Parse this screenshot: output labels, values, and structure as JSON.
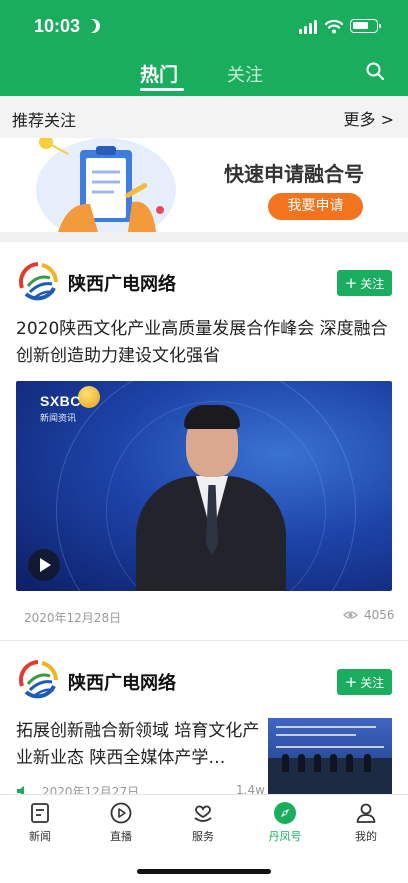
{
  "status_bar": {
    "time": "10:03"
  },
  "header": {
    "tabs": [
      {
        "label": "热门",
        "active": true
      },
      {
        "label": "关注",
        "active": false
      }
    ],
    "search_icon": "search-icon"
  },
  "recommend": {
    "title": "推荐关注",
    "more": "更多 >"
  },
  "banner": {
    "title": "快速申请融合号",
    "button": "我要申请"
  },
  "feed": [
    {
      "account": "陕西广电网络",
      "follow_label": "关注",
      "headline": "2020陕西文化产业高质量发展合作峰会 深度融合创新创造助力建设文化强省",
      "video": {
        "logo": "SXBC",
        "logo_sub": "新闻资讯"
      },
      "date": "2020年12月28日",
      "views": "4056"
    },
    {
      "account": "陕西广电网络",
      "follow_label": "关注",
      "headline": "拓展创新融合新领域 培育文化产业新业态 陕西全媒体产学…",
      "date": "2020年12月27日",
      "views": "1.4w"
    }
  ],
  "tabbar": {
    "items": [
      {
        "label": "新闻",
        "icon": "news-icon"
      },
      {
        "label": "直播",
        "icon": "play-circle-icon"
      },
      {
        "label": "服务",
        "icon": "service-heart-icon"
      },
      {
        "label": "丹凤号",
        "icon": "compass-icon",
        "active": true
      },
      {
        "label": "我的",
        "icon": "profile-icon"
      }
    ]
  },
  "colors": {
    "brand_green": "#1aad5e",
    "orange": "#f3731f"
  }
}
